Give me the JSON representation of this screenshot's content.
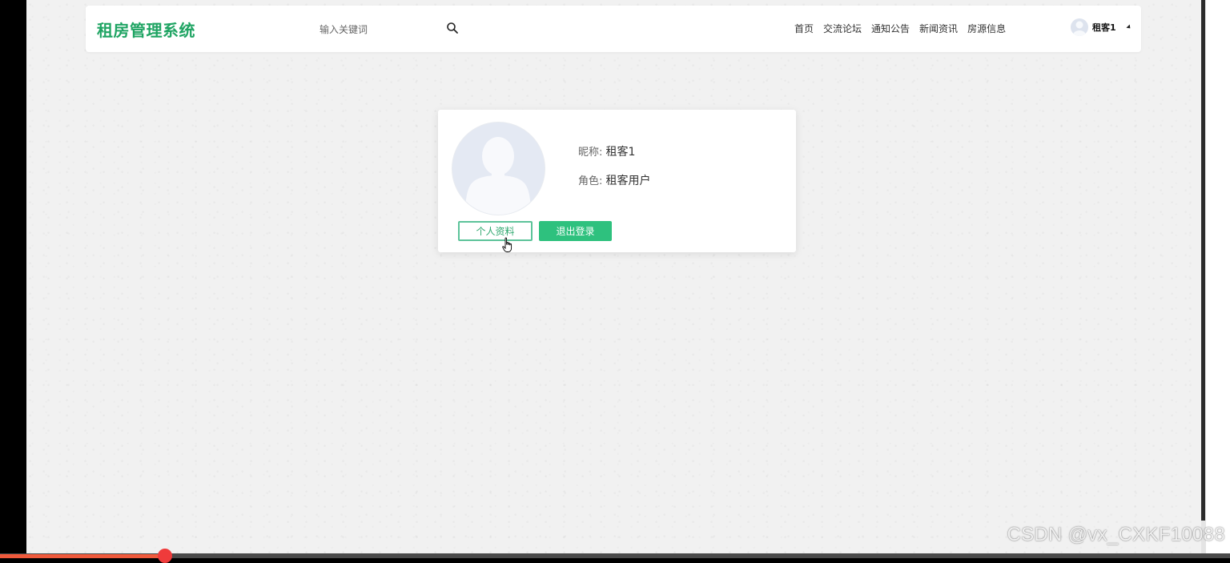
{
  "header": {
    "brand": "租房管理系统",
    "search_placeholder": "输入关键词",
    "nav": [
      "首页",
      "交流论坛",
      "通知公告",
      "新闻资讯",
      "房源信息"
    ],
    "user_name": "租客1"
  },
  "profile_card": {
    "nickname_label": "昵称: ",
    "nickname_value": "租客1",
    "role_label": "角色: ",
    "role_value": "租客用户",
    "profile_button": "个人资料",
    "logout_button": "退出登录"
  },
  "watermark": "CSDN @vx_CXKF10088",
  "colors": {
    "brand": "#1fa463",
    "accent": "#2ec17e",
    "page_bg": "#f1f1f1"
  },
  "icons": {
    "search": "search-icon",
    "avatar": "user-avatar-icon",
    "dropdown": "caret-down-icon"
  }
}
